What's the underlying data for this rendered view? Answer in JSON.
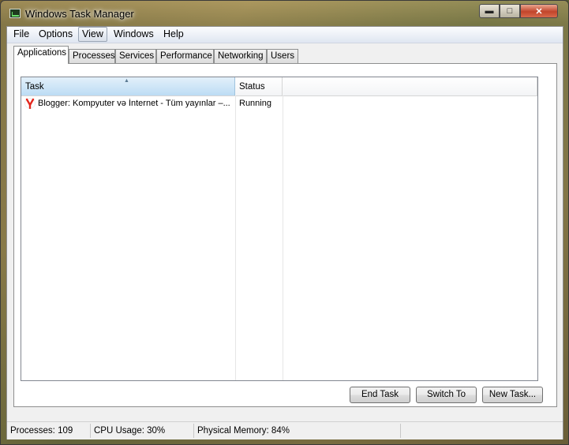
{
  "window": {
    "title": "Windows Task Manager"
  },
  "menu": {
    "items": [
      "File",
      "Options",
      "View",
      "Windows",
      "Help"
    ],
    "active": "View"
  },
  "tabs": [
    "Applications",
    "Processes",
    "Services",
    "Performance",
    "Networking",
    "Users"
  ],
  "selected_tab": "Applications",
  "list": {
    "columns": [
      "Task",
      "Status"
    ],
    "sort_indicator": "▲",
    "rows": [
      {
        "task": "Blogger: Kompyuter və İnternet - Tüm yayınlar –...",
        "status": "Running",
        "icon": "yandex-browser-icon"
      }
    ]
  },
  "buttons": {
    "end_task": "End Task",
    "switch_to": "Switch To",
    "new_task": "New Task..."
  },
  "statusbar": {
    "processes": "Processes: 109",
    "cpu": "CPU Usage: 30%",
    "memory": "Physical Memory: 84%"
  },
  "colors": {
    "close_button": "#c2452b",
    "header_selected": "#bcdcf4"
  }
}
